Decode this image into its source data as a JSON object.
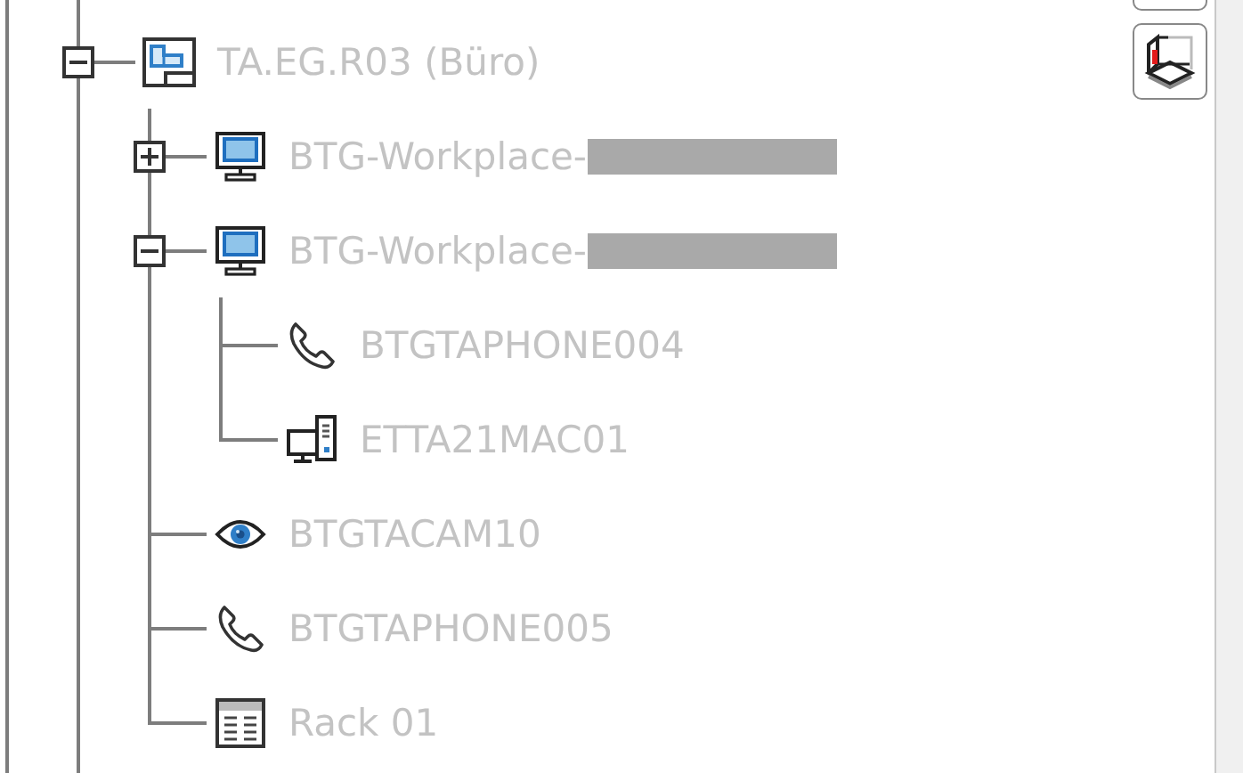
{
  "tree": [
    {
      "kind": "room",
      "label": "TA.EG.R03 (Büro)",
      "expanded": true,
      "children": [
        {
          "kind": "workstation",
          "label": "BTG-Workplace-",
          "redacted": true,
          "expanded": false
        },
        {
          "kind": "workstation",
          "label": "BTG-Workplace-",
          "redacted": true,
          "expanded": true,
          "children": [
            {
              "kind": "phone",
              "label": "BTGTAPHONE004"
            },
            {
              "kind": "computer",
              "label": "ETTA21MAC01"
            }
          ]
        },
        {
          "kind": "camera",
          "label": "BTGTACAM10"
        },
        {
          "kind": "phone",
          "label": "BTGTAPHONE005"
        },
        {
          "kind": "rack",
          "label": "Rack 01"
        }
      ]
    }
  ]
}
